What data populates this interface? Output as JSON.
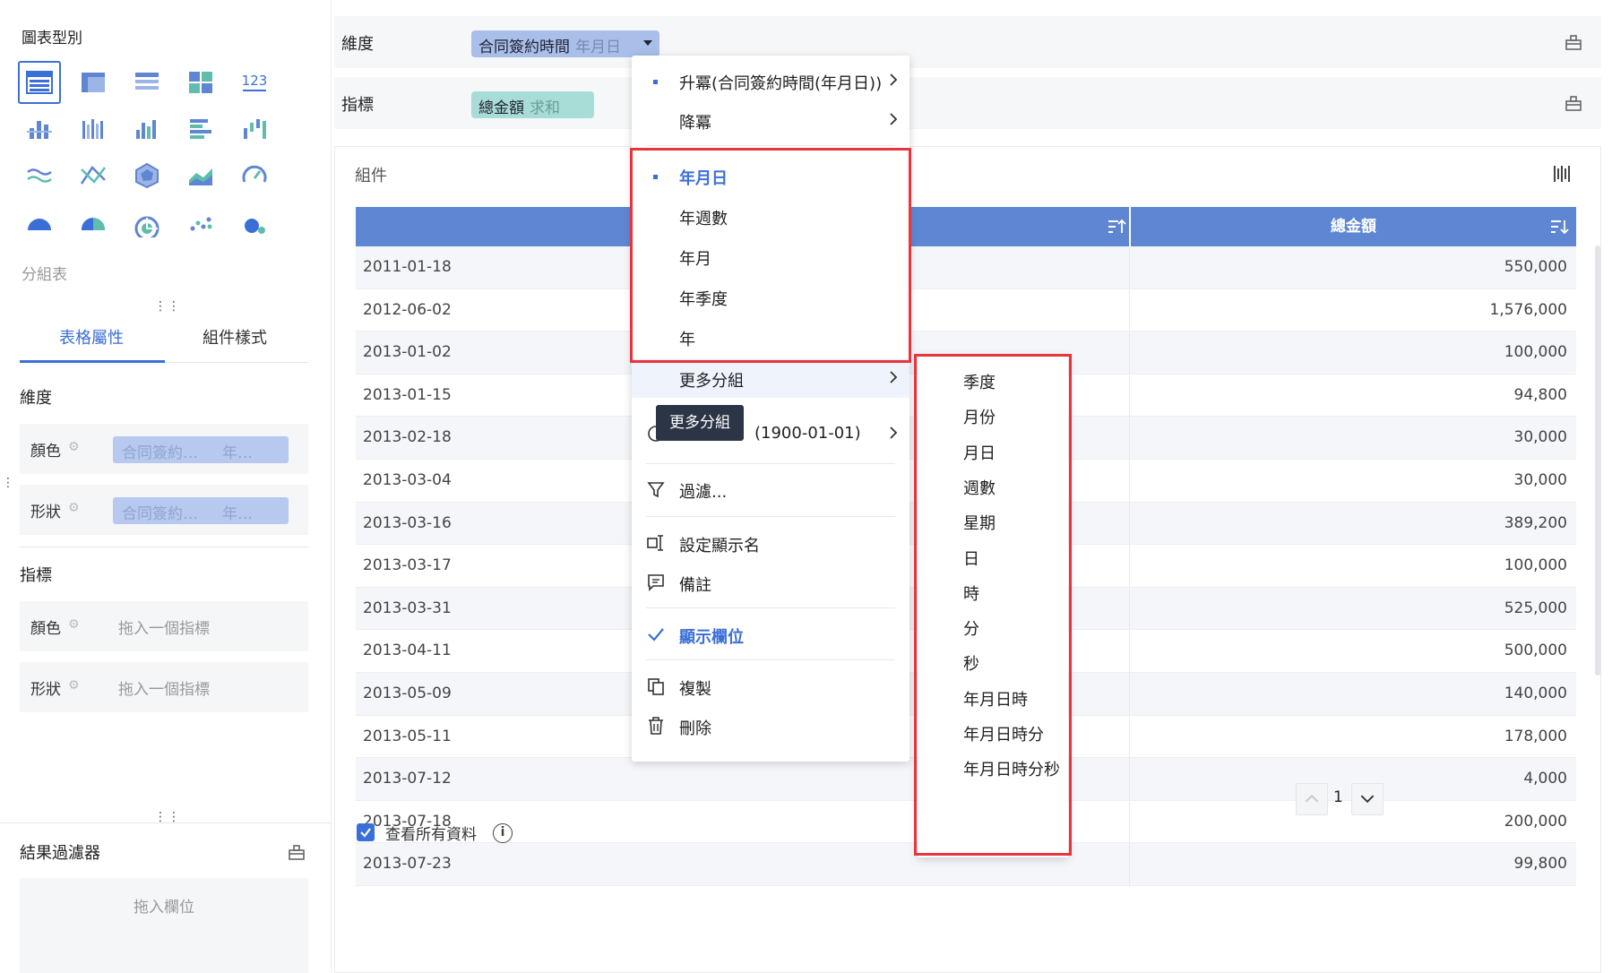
{
  "left_panel": {
    "chart_type_title": "圖表型別",
    "selected_chart_label": "分組表",
    "tabs": [
      "表格屬性",
      "組件樣式"
    ],
    "dimension_section": "維度",
    "dim_rows": [
      {
        "label": "顏色",
        "chip_a": "合同簽約…",
        "chip_b": "年…"
      },
      {
        "label": "形狀",
        "chip_a": "合同簽約…",
        "chip_b": "年…"
      }
    ],
    "metric_section": "指標",
    "metric_rows": [
      {
        "label": "顏色",
        "placeholder": "拖入一個指標"
      },
      {
        "label": "形狀",
        "placeholder": "拖入一個指標"
      }
    ],
    "result_filter_title": "結果過濾器",
    "drop_field_placeholder": "拖入欄位"
  },
  "top": {
    "dimension_label": "維度",
    "dimension_pill": {
      "name": "合同簽約時間",
      "sub": "年月日"
    },
    "metric_label": "指標",
    "metric_pill": {
      "name": "總金額",
      "sub": "求和"
    }
  },
  "card": {
    "title": "組件",
    "table": {
      "columns": [
        "",
        "總金額"
      ],
      "rows": [
        [
          "2011-01-18",
          "550,000"
        ],
        [
          "2012-06-02",
          "1,576,000"
        ],
        [
          "2013-01-02",
          "100,000"
        ],
        [
          "2013-01-15",
          "94,800"
        ],
        [
          "2013-02-18",
          "30,000"
        ],
        [
          "2013-03-04",
          "30,000"
        ],
        [
          "2013-03-16",
          "389,200"
        ],
        [
          "2013-03-17",
          "100,000"
        ],
        [
          "2013-03-31",
          "525,000"
        ],
        [
          "2013-04-11",
          "500,000"
        ],
        [
          "2013-05-09",
          "140,000"
        ],
        [
          "2013-05-11",
          "178,000"
        ],
        [
          "2013-07-12",
          "4,000"
        ],
        [
          "2013-07-18",
          "200,000"
        ],
        [
          "2013-07-23",
          "99,800"
        ]
      ]
    },
    "page_number": "1",
    "view_all_label": "查看所有資料"
  },
  "menu": {
    "sort_asc": "升冪(合同簽約時間(年月日))",
    "sort_desc": "降冪",
    "groupings": [
      "年月日",
      "年週數",
      "年月",
      "年季度",
      "年"
    ],
    "more_groups": "更多分組",
    "tooltip": "更多分組",
    "date_base": "(1900-01-01)",
    "filter": "過濾...",
    "set_display_name": "設定顯示名",
    "note": "備註",
    "show_field": "顯示欄位",
    "copy": "複製",
    "delete": "刪除"
  },
  "submenu": {
    "items": [
      "季度",
      "月份",
      "月日",
      "週數",
      "星期",
      "日",
      "時",
      "分",
      "秒",
      "年月日時",
      "年月日時分",
      "年月日時分秒"
    ]
  },
  "colors": {
    "accent": "#3b6fd8",
    "table_header": "#5f86d3",
    "highlight_box": "#e8353d"
  }
}
